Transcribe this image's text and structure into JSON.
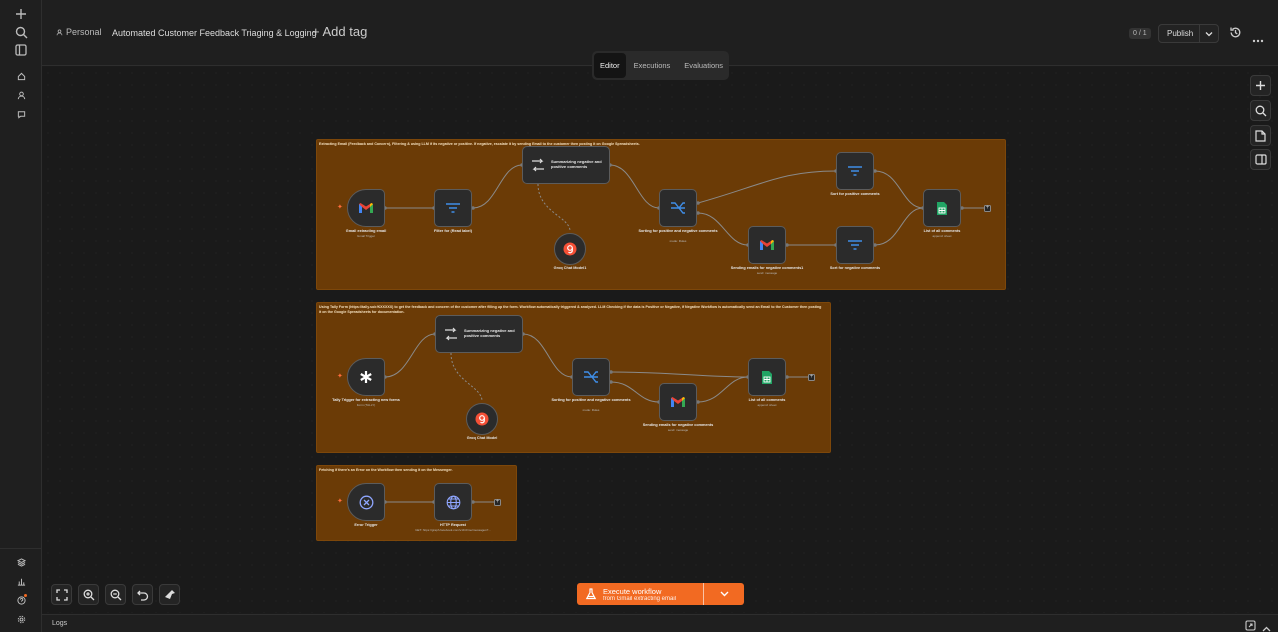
{
  "header": {
    "project": "Personal",
    "workflow_name": "Automated Customer Feedback Triaging & Logging",
    "add_tag": "+ Add tag",
    "version_badge": "0 / 1",
    "publish_label": "Publish"
  },
  "tabs": [
    {
      "label": "Editor",
      "active": true
    },
    {
      "label": "Executions",
      "active": false
    },
    {
      "label": "Evaluations",
      "active": false
    }
  ],
  "sticky_notes": [
    {
      "text": "Extracting Email (Feedback and Concern), Filtering & using LLM if its negative or positive. If negative, escalate it by sending Email to the customer then posting it on Google Spreadsheets."
    },
    {
      "text": "Using Tally Form (https://tally.so/r/KXXXXX) to get the feedback and concern of the customer after filling up the form. Workflow automatically triggered & analyzed. LLM Checking if the data is Positive or Negative, if Negative Workflow is automatically send an Email to the Customer then posting it on the Google Spreadsheets for documentation."
    },
    {
      "text": "Fetching if there's an Error on the Workflow then sending it on the Messenger."
    }
  ],
  "nodes": {
    "gmail_trigger": {
      "label": "Gmail extracting email",
      "sub": "Gmail Trigger"
    },
    "filter_read": {
      "label": "Filter for (Read label)",
      "sub": ""
    },
    "agent1": {
      "label": "Summarizing negative and positive comments"
    },
    "groq1": {
      "label": "Groq Chat Model1"
    },
    "switch1": {
      "label": "Sorting for positive and negative comments",
      "sub": "mode: Rules"
    },
    "sort_pos": {
      "label": "Sort for positive comments",
      "sub": ""
    },
    "gmail_send1": {
      "label": "Sending emails for negative comments1",
      "sub": "send: message"
    },
    "sort_neg": {
      "label": "Sort for negative comments",
      "sub": ""
    },
    "sheets1": {
      "label": "List of all comments",
      "sub": "append: sheet"
    },
    "tally_trigger": {
      "label": "Tally Trigger for extracting new forms",
      "sub": "Form (TALLY)"
    },
    "agent2": {
      "label": "Summarizing negative and positive comments"
    },
    "groq2": {
      "label": "Groq Chat Model"
    },
    "switch2": {
      "label": "Sorting for positive and negative comments",
      "sub": "mode: Rules"
    },
    "gmail_send2": {
      "label": "Sending emails for negative comments",
      "sub": "send: message"
    },
    "sheets2": {
      "label": "List of all comments",
      "sub": "append: sheet"
    },
    "error_trigger": {
      "label": "Error Trigger",
      "sub": ""
    },
    "http": {
      "label": "HTTP Request",
      "sub": "GET: https://graph.facebook.com/v19.0/me/messages?..."
    }
  },
  "execute": {
    "title": "Execute workflow",
    "subtitle": "from Gmail extracting email"
  },
  "logs_label": "Logs",
  "colors": {
    "accent": "#f26a22",
    "sticky": "#6b3b06",
    "gmail_red": "#ea4335",
    "sheets_green": "#21a464",
    "filter_blue": "#3f8ee8"
  }
}
